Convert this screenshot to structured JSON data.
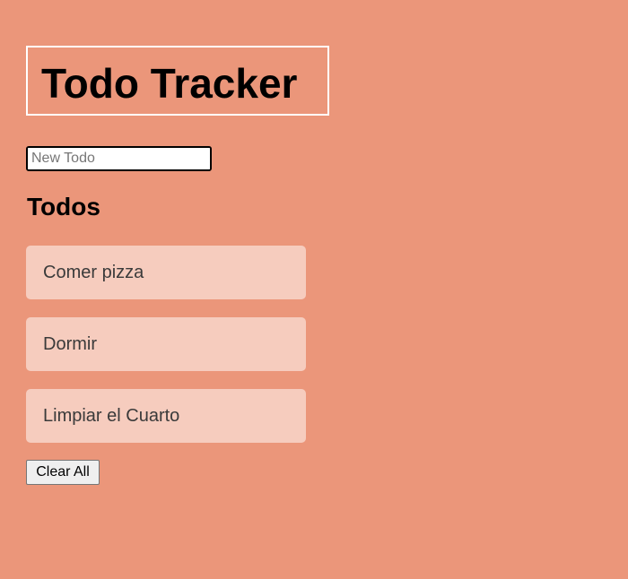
{
  "header": {
    "title": "Todo Tracker"
  },
  "new_todo": {
    "placeholder": "New Todo",
    "value": ""
  },
  "list": {
    "heading": "Todos",
    "items": [
      {
        "label": "Comer pizza"
      },
      {
        "label": "Dormir"
      },
      {
        "label": "Limpiar el Cuarto"
      }
    ]
  },
  "actions": {
    "clear_label": "Clear All"
  },
  "colors": {
    "background": "#EB967A",
    "item_background": "#F6CCBE",
    "title_border": "#FFFFFF"
  }
}
